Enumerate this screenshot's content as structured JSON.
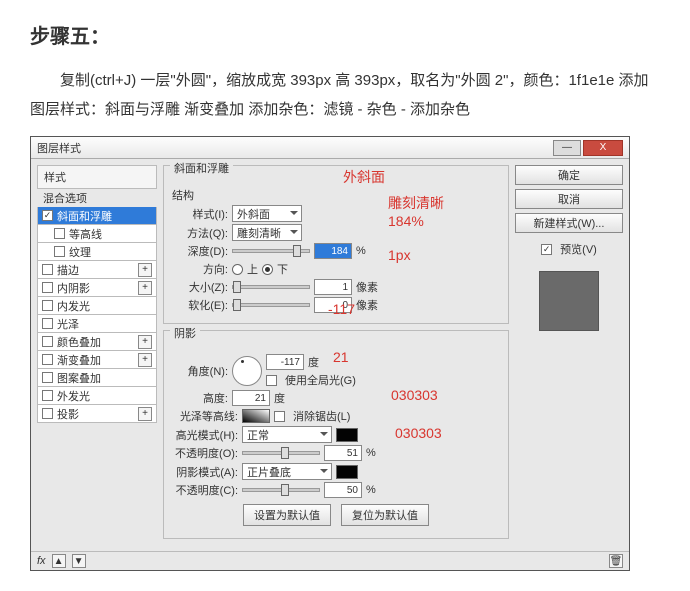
{
  "heading": "步骤五：",
  "desc": "复制(ctrl+J) 一层\"外圆\"，缩放成宽 393px 高 393px，取名为\"外圆 2\"，颜色：1f1e1e 添加图层样式：斜面与浮雕 渐变叠加 添加杂色：滤镜 - 杂色 - 添加杂色",
  "titlebar": "图层样式",
  "win": {
    "min": "—",
    "close": "X"
  },
  "left": {
    "head": "样式",
    "blend": "混合选项",
    "items": [
      {
        "label": "斜面和浮雕",
        "checked": true,
        "sel": true,
        "plus": false
      },
      {
        "label": "等高线",
        "checked": false,
        "sel": false,
        "plus": false,
        "indent": true
      },
      {
        "label": "纹理",
        "checked": false,
        "sel": false,
        "plus": false,
        "indent": true
      },
      {
        "label": "描边",
        "checked": false,
        "sel": false,
        "plus": true
      },
      {
        "label": "内阴影",
        "checked": false,
        "sel": false,
        "plus": true
      },
      {
        "label": "内发光",
        "checked": false,
        "sel": false,
        "plus": false
      },
      {
        "label": "光泽",
        "checked": false,
        "sel": false,
        "plus": false
      },
      {
        "label": "颜色叠加",
        "checked": false,
        "sel": false,
        "plus": true
      },
      {
        "label": "渐变叠加",
        "checked": false,
        "sel": false,
        "plus": true
      },
      {
        "label": "图案叠加",
        "checked": false,
        "sel": false,
        "plus": false
      },
      {
        "label": "外发光",
        "checked": false,
        "sel": false,
        "plus": false
      },
      {
        "label": "投影",
        "checked": false,
        "sel": false,
        "plus": true
      }
    ]
  },
  "mid": {
    "group1_title": "斜面和浮雕",
    "struct_head": "结构",
    "style_lbl": "样式(I):",
    "style_val": "外斜面",
    "method_lbl": "方法(Q):",
    "method_val": "雕刻清晰",
    "depth_lbl": "深度(D):",
    "depth_val": "184",
    "depth_unit": "%",
    "dir_lbl": "方向:",
    "dir_up": "上",
    "dir_down": "下",
    "size_lbl": "大小(Z):",
    "size_val": "1",
    "size_unit": "像素",
    "soft_lbl": "软化(E):",
    "soft_val": "0",
    "soft_unit": "像素",
    "group2_title": "阴影",
    "angle_lbl": "角度(N):",
    "angle_val": "-117",
    "angle_unit": "度",
    "global_lbl": "使用全局光(G)",
    "alt_lbl": "高度:",
    "alt_val": "21",
    "alt_unit": "度",
    "gloss_lbl": "光泽等高线:",
    "anti_lbl": "消除锯齿(L)",
    "hmode_lbl": "高光模式(H):",
    "hmode_val": "正常",
    "hopac_lbl": "不透明度(O):",
    "hopac_val": "51",
    "hopac_unit": "%",
    "smode_lbl": "阴影模式(A):",
    "smode_val": "正片叠底",
    "sopac_lbl": "不透明度(C):",
    "sopac_val": "50",
    "sopac_unit": "%",
    "defaults_btn": "设置为默认值",
    "reset_btn": "复位为默认值"
  },
  "right": {
    "ok": "确定",
    "cancel": "取消",
    "newstyle": "新建样式(W)...",
    "preview_lbl": "预览(V)"
  },
  "annot": {
    "a1": "外斜面",
    "a2": "雕刻清晰",
    "a3": "184%",
    "a4": "1px",
    "a5": "-117",
    "a6": "21",
    "a7": "030303",
    "a8": "030303"
  },
  "foot": {
    "fx": "fx"
  }
}
